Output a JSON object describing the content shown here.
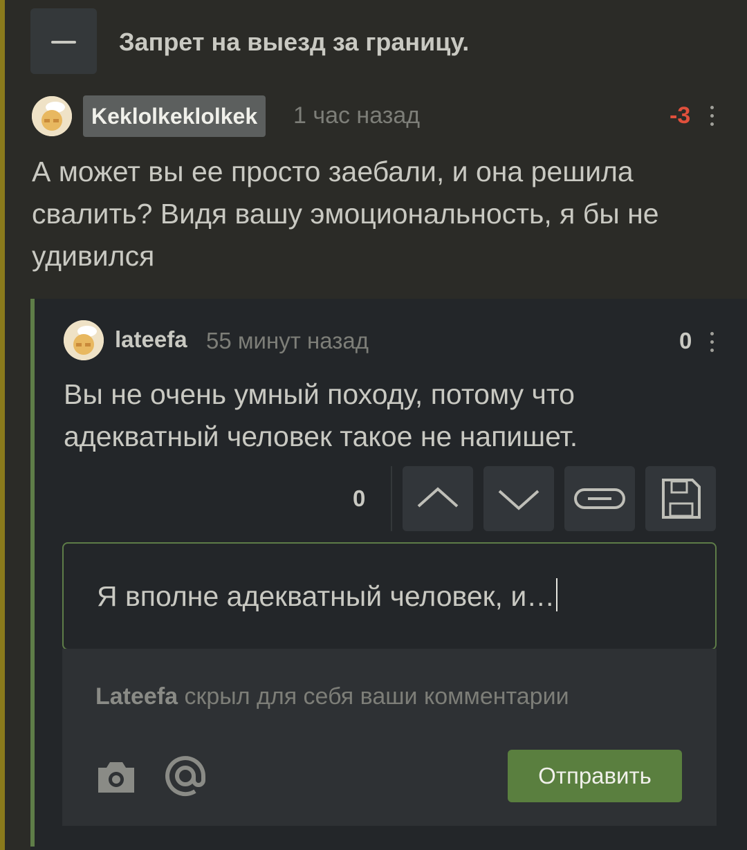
{
  "header": {
    "title": "Запрет на выезд за границу."
  },
  "comments": [
    {
      "username": "Keklolkeklolkek",
      "time": "1 час назад",
      "score": "-3",
      "text": "А может вы ее просто заебали, и она решила свалить? Видя вашу эмоциональность, я бы не удивился"
    },
    {
      "username": "lateefa",
      "time": "55 минут назад",
      "score": "0",
      "text": "Вы не очень умный походу, потому что адекватный человек такое не напишет."
    }
  ],
  "actions": {
    "vote_count": "0",
    "icons": [
      "chevron-up-icon",
      "chevron-down-icon",
      "link-icon",
      "save-icon"
    ]
  },
  "reply": {
    "value": "Я вполне адекватный человек, и…",
    "notice_user": "Lateefa",
    "notice_text": "скрыл для себя ваши комментарии",
    "send_label": "Отправить"
  },
  "colors": {
    "background": "#2b2b27",
    "panel": "#232629",
    "accent_green": "#5a7f3f",
    "negative_score": "#e0503c",
    "rail": "#8a7a1c"
  }
}
